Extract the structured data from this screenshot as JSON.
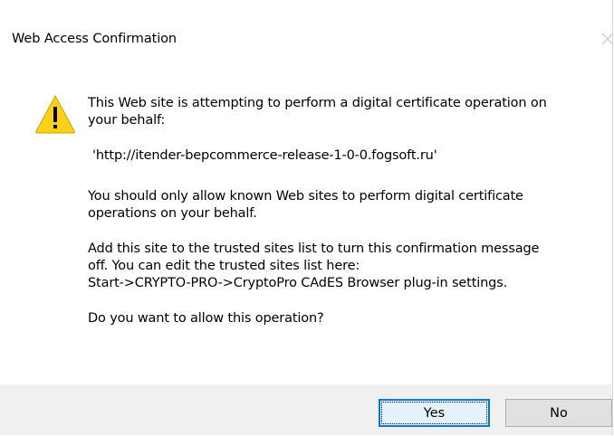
{
  "dialog": {
    "title": "Web Access Confirmation",
    "close_icon": "close-icon",
    "warning_icon": "warning-icon",
    "message": "This Web site is attempting to perform a digital certificate operation on\nyour behalf:",
    "url": "'http://itender-bepcommerce-release-1-0-0.fogsoft.ru'",
    "known_sites_text": "You should only allow known Web sites to perform digital certificate\noperations on your behalf.",
    "trusted_sites_text": "Add this site to the trusted sites list to turn this confirmation message\noff. You can edit the trusted sites list here:\nStart->CRYPTO-PRO->CryptoPro CAdES Browser plug-in settings.",
    "question": "Do you want to allow this operation?",
    "buttons": {
      "yes": "Yes",
      "no": "No"
    },
    "colors": {
      "footer_bg": "#f0f0f0",
      "button_bg": "#e1e1e1",
      "focus_border": "#0078d7",
      "warning_fill": "#fcd116"
    }
  }
}
